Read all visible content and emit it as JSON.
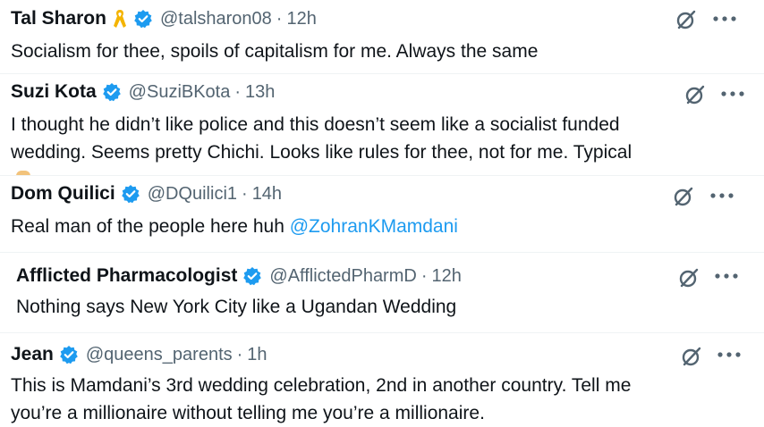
{
  "tweets": [
    {
      "name": "Tal Sharon",
      "handle": "@talsharon08",
      "separator": "·",
      "time": "12h",
      "text_lines": [
        "Socialism for thee, spoils of capitalism for me. Always the same"
      ],
      "badge_ribbon": true
    },
    {
      "name": "Suzi Kota",
      "handle": "@SuziBKota",
      "separator": "·",
      "time": "13h",
      "text_lines": [
        "I thought he didn’t like police and this doesn’t seem like a socialist funded",
        "wedding. Seems pretty Chichi. Looks like rules for thee, not for me. Typical"
      ]
    },
    {
      "name": "Dom Quilici",
      "handle": "@DQuilici1",
      "separator": "·",
      "time": "14h",
      "text_prefix": "Real man of the people here huh ",
      "mention": "@ZohranKMamdani"
    },
    {
      "name": "Afflicted Pharmacologist",
      "handle": "@AfflictedPharmD",
      "separator": "·",
      "time": "12h",
      "text_lines": [
        "Nothing says New York City like a Ugandan Wedding"
      ]
    },
    {
      "name": "Jean",
      "handle": "@queens_parents",
      "separator": "·",
      "time": "1h",
      "text_lines": [
        "This is Mamdani’s 3rd wedding celebration, 2nd in another country. Tell me",
        "you’re a millionaire without telling me you’re a millionaire."
      ]
    }
  ],
  "icons": {
    "verified": "verified-badge-icon",
    "ribbon": "yellow-ribbon-icon",
    "grok": "grok-icon",
    "more": "more-options-icon"
  },
  "colors": {
    "text": "#0f1419",
    "secondary": "#536471",
    "verified": "#1d9bf0",
    "mention": "#1d9bf0",
    "ribbon": "#f4b400",
    "icons": "#536471"
  }
}
